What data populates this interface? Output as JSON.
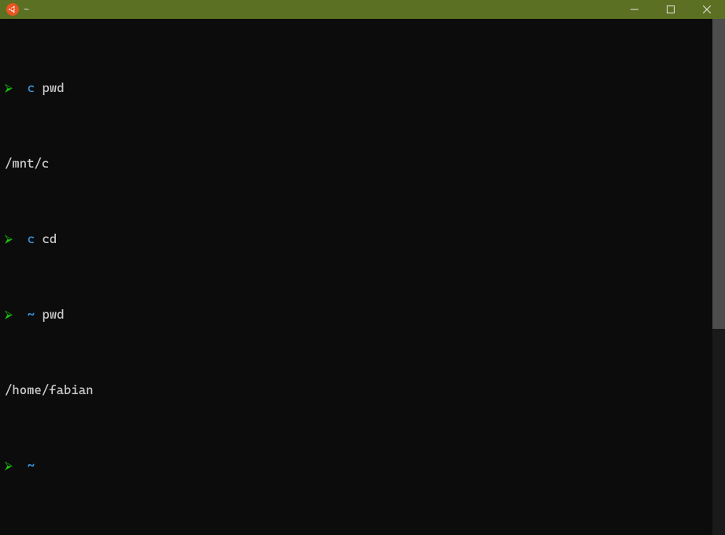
{
  "window": {
    "title": "~",
    "icon": "ubuntu-icon"
  },
  "terminal": {
    "lines": [
      {
        "prompt_glyph": "⮚",
        "dir": "c",
        "cmd": "pwd"
      },
      {
        "output": "/mnt/c"
      },
      {
        "prompt_glyph": "⮚",
        "dir": "c",
        "cmd": "cd"
      },
      {
        "prompt_glyph": "⮚",
        "dir": "~",
        "cmd": "pwd"
      },
      {
        "output": "/home/fabian"
      },
      {
        "prompt_glyph": "⮚",
        "dir": "~",
        "cmd": ""
      }
    ]
  },
  "colors": {
    "titlebar_bg": "#5b7022",
    "terminal_bg": "#0c0c0c",
    "prompt_green": "#16c60c",
    "dir_cyan": "#3a96dd",
    "text_white": "#cccccc",
    "ubuntu_orange": "#E95420"
  }
}
